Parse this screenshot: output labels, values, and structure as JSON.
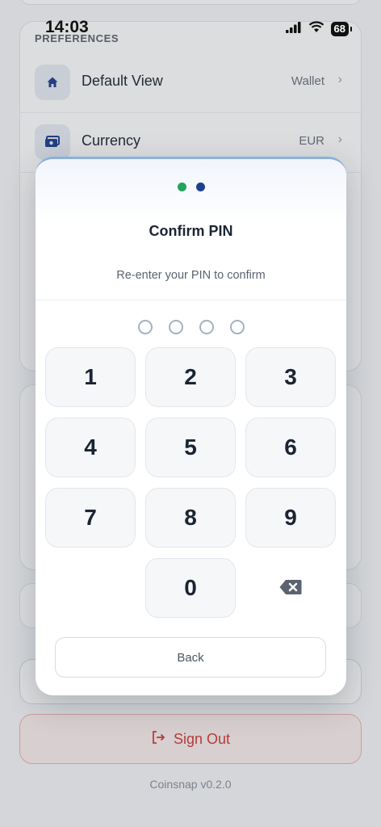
{
  "status_bar": {
    "time": "14:03",
    "battery": "68"
  },
  "preferences": {
    "section_label": "PREFERENCES",
    "rows": [
      {
        "label": "Default View",
        "value": "Wallet",
        "icon": "home-icon"
      },
      {
        "label": "Currency",
        "value": "EUR",
        "icon": "banknote-icon"
      }
    ]
  },
  "signout": {
    "label": "Sign Out",
    "icon": "sign-out-icon",
    "color": "#d23a3a"
  },
  "version": "Coinsnap v0.2.0",
  "modal": {
    "steps": [
      {
        "state": "done",
        "color": "#22a45d"
      },
      {
        "state": "current",
        "color": "#1f3f8f"
      }
    ],
    "title": "Confirm PIN",
    "subtitle": "Re-enter your PIN to confirm",
    "pin_length": 4,
    "pin_entered": 0,
    "keys": [
      "1",
      "2",
      "3",
      "4",
      "5",
      "6",
      "7",
      "8",
      "9",
      "",
      "0",
      "backspace"
    ],
    "back_label": "Back"
  }
}
